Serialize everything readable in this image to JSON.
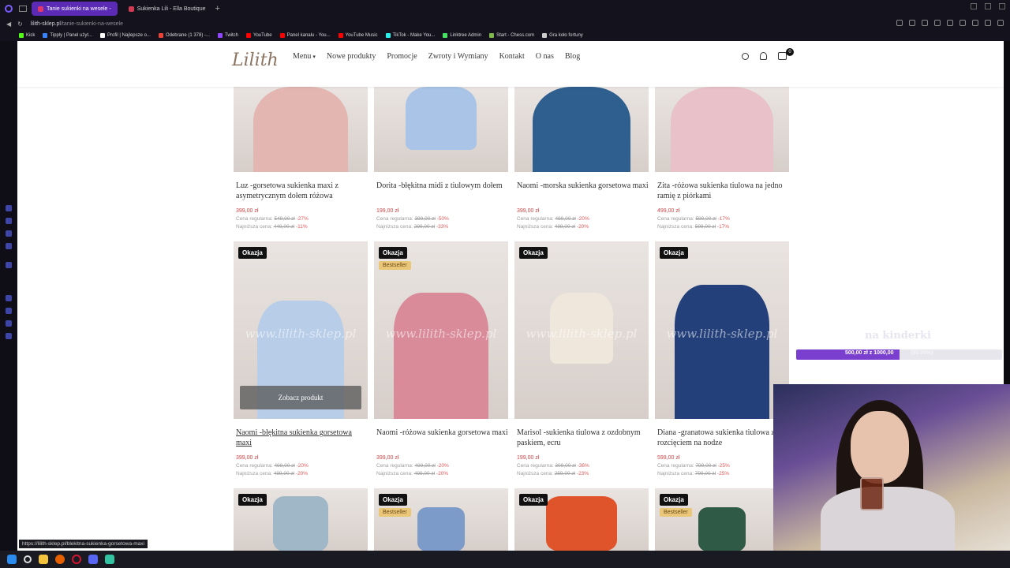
{
  "browser": {
    "tabs": [
      {
        "label": "Tanie sukienki na wesele -",
        "active": true,
        "color": "#e0376b"
      },
      {
        "label": "Sukienka Lili - Ella Boutique",
        "active": false,
        "color": "#d33b52"
      }
    ],
    "new_tab": "+",
    "url_host": "lilith-sklep.pl",
    "url_path": "/tanie-sukienki-na-wesele",
    "bookmarks": [
      {
        "label": "Kick",
        "color": "#53fc18"
      },
      {
        "label": "Tipply | Panel użyt...",
        "color": "#3b82f6"
      },
      {
        "label": "Profil | Najlepsze o...",
        "color": "#ffffff"
      },
      {
        "label": "Odebrane (1 378) -...",
        "color": "#ea4335"
      },
      {
        "label": "Twitch",
        "color": "#9146ff"
      },
      {
        "label": "YouTube",
        "color": "#ff0000"
      },
      {
        "label": "Panel kanału - You...",
        "color": "#ff0000"
      },
      {
        "label": "YouTube Music",
        "color": "#ff0000"
      },
      {
        "label": "TikTok - Make You...",
        "color": "#25f4ee"
      },
      {
        "label": "Linktree Admin",
        "color": "#43e660"
      },
      {
        "label": "Start - Chess.com",
        "color": "#81b64c"
      },
      {
        "label": "Gra koło fortuny",
        "color": "#cccccc"
      }
    ]
  },
  "site": {
    "logo": "Lilith",
    "nav": [
      "Menu",
      "Nowe produkty",
      "Promocje",
      "Zwroty i Wymiany",
      "Kontakt",
      "O nas",
      "Blog"
    ],
    "cart_count": "0"
  },
  "labels": {
    "regular": "Cena regularna:",
    "lowest": "Najniższa cena:",
    "deal": "Okazja",
    "bestseller": "Bestseller",
    "see_product": "Zobacz produkt",
    "watermark": "www.lilith-sklep.pl"
  },
  "products_row1": [
    {
      "title": "Luz -gorsetowa sukienka maxi z asymetrycznym dołem różowa",
      "price": "399,00 zł",
      "regular": "549,00 zł",
      "regular_pct": "-27%",
      "lowest": "449,00 zł",
      "lowest_pct": "-11%",
      "color": "#e3b6b2"
    },
    {
      "title": "Dorita -błękitna midi z tiulowym dołem",
      "price": "199,00 zł",
      "regular": "399,00 zł",
      "regular_pct": "-50%",
      "lowest": "299,00 zł",
      "lowest_pct": "-33%",
      "color": "#a9c4e6"
    },
    {
      "title": "Naomi -morska sukienka gorsetowa maxi",
      "price": "399,00 zł",
      "regular": "499,00 zł",
      "regular_pct": "-20%",
      "lowest": "499,00 zł",
      "lowest_pct": "-20%",
      "color": "#2f5f8f"
    },
    {
      "title": "Zita -różowa sukienka tiulowa na jedno ramię z piórkami",
      "price": "499,00 zł",
      "regular": "599,00 zł",
      "regular_pct": "-17%",
      "lowest": "599,00 zł",
      "lowest_pct": "-17%",
      "color": "#e8c2c8"
    }
  ],
  "products_row2": [
    {
      "title": "Naomi -błękitna sukienka gorsetowa maxi",
      "price": "399,00 zł",
      "regular": "499,00 zł",
      "regular_pct": "-20%",
      "lowest": "499,00 zł",
      "lowest_pct": "-20%",
      "bestseller": false,
      "hover": true,
      "color": "#b7cde8"
    },
    {
      "title": "Naomi -różowa sukienka gorsetowa maxi",
      "price": "399,00 zł",
      "regular": "499,00 zł",
      "regular_pct": "-20%",
      "lowest": "499,00 zł",
      "lowest_pct": "-20%",
      "bestseller": true,
      "hover": false,
      "color": "#d98b9a"
    },
    {
      "title": "Marisol -sukienka tiulowa z ozdobnym paskiem, ecru",
      "price": "199,00 zł",
      "regular": "309,00 zł",
      "regular_pct": "-36%",
      "lowest": "259,00 zł",
      "lowest_pct": "-23%",
      "bestseller": false,
      "hover": false,
      "color": "#efe6dc"
    },
    {
      "title": "Diana -granatowa sukienka tiulowa z rozcięciem na nodze",
      "price": "599,00 zł",
      "regular": "799,00 zł",
      "regular_pct": "-25%",
      "lowest": "799,00 zł",
      "lowest_pct": "-25%",
      "bestseller": false,
      "hover": false,
      "color": "#23407a"
    }
  ],
  "products_row3": [
    {
      "bestseller": false,
      "color": "#9fb7c7"
    },
    {
      "bestseller": true,
      "color": "#7d9bc9"
    },
    {
      "bestseller": false,
      "color": "#e0542b"
    },
    {
      "bestseller": true,
      "color": "#2e5a46"
    }
  ],
  "status_link": "https://lilith-sklep.pl/blekitna-sukienka-gorsetowa-maxi",
  "stream": {
    "goal_title": "na kinderki",
    "goal_amount": "500,00 zł  z  1000,00",
    "goal_pct_label": "(50.00%)",
    "goal_progress": 0.5
  }
}
